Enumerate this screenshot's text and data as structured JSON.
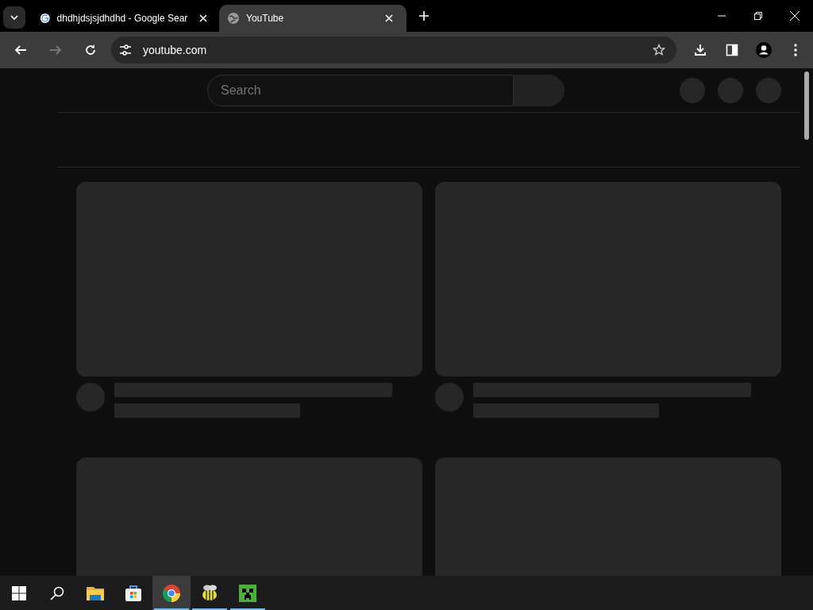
{
  "tabs": [
    {
      "title": "dhdhjdsjsjdhdhd - Google Sear",
      "kind": "google",
      "selected": false
    },
    {
      "title": "YouTube",
      "kind": "globe",
      "selected": true
    }
  ],
  "nav_buttons": [
    {
      "kind": "back",
      "disabled": false
    },
    {
      "kind": "forward",
      "disabled": true
    },
    {
      "kind": "reload",
      "disabled": false
    }
  ],
  "address_bar": {
    "url": "youtube.com"
  },
  "page": {
    "search": {
      "placeholder": "Search"
    }
  },
  "taskbar": {
    "apps": [
      {
        "kind": "files",
        "running": false,
        "selected": false
      },
      {
        "kind": "store",
        "running": false,
        "selected": false
      },
      {
        "kind": "chrome",
        "running": true,
        "selected": true
      },
      {
        "kind": "bee",
        "running": true,
        "selected": false
      },
      {
        "kind": "creeper",
        "running": true,
        "selected": false
      }
    ]
  }
}
